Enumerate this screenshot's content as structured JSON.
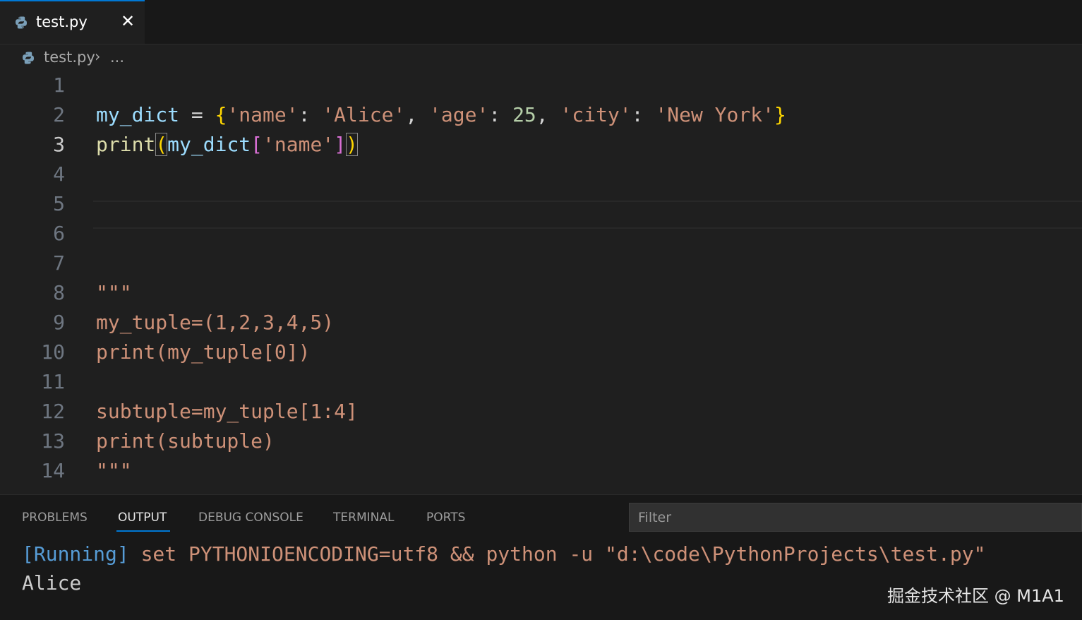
{
  "tab": {
    "filename": "test.py",
    "close_glyph": "✕",
    "icon": "python-icon"
  },
  "breadcrumb": {
    "filename": "test.py",
    "separator": "›",
    "more": "..."
  },
  "editor": {
    "active_line": 3,
    "line_numbers": [
      "1",
      "2",
      "3",
      "4",
      "5",
      "6",
      "7",
      "8",
      "9",
      "10",
      "11",
      "12",
      "13",
      "14"
    ],
    "lines": [
      "",
      "my_dict = {'name': 'Alice', 'age': 25, 'city': 'New York'}",
      "print(my_dict['name'])",
      "",
      "",
      "",
      "",
      "\"\"\"",
      "my_tuple=(1,2,3,4,5)",
      "print(my_tuple[0])",
      "",
      "subtuple=my_tuple[1:4]",
      "print(subtuple)",
      "\"\"\""
    ]
  },
  "panel": {
    "tabs": [
      "PROBLEMS",
      "OUTPUT",
      "DEBUG CONSOLE",
      "TERMINAL",
      "PORTS"
    ],
    "active_tab": "OUTPUT",
    "filter_placeholder": "Filter",
    "output": {
      "running_tag": "[Running]",
      "command": " set PYTHONIOENCODING=utf8 && python -u \"d:\\code\\PythonProjects\\test.py\"",
      "result": "Alice"
    }
  },
  "watermark": "掘金技术社区 @ M1A1",
  "colors": {
    "accent": "#0078d4",
    "editor_bg": "#1f1f1f",
    "string": "#ce9178",
    "variable": "#9cdcfe",
    "function": "#dcdcaa",
    "number": "#b5cea8",
    "bracket_1": "#ffd700",
    "bracket_2": "#da70d6",
    "bracket_3": "#179fff"
  }
}
